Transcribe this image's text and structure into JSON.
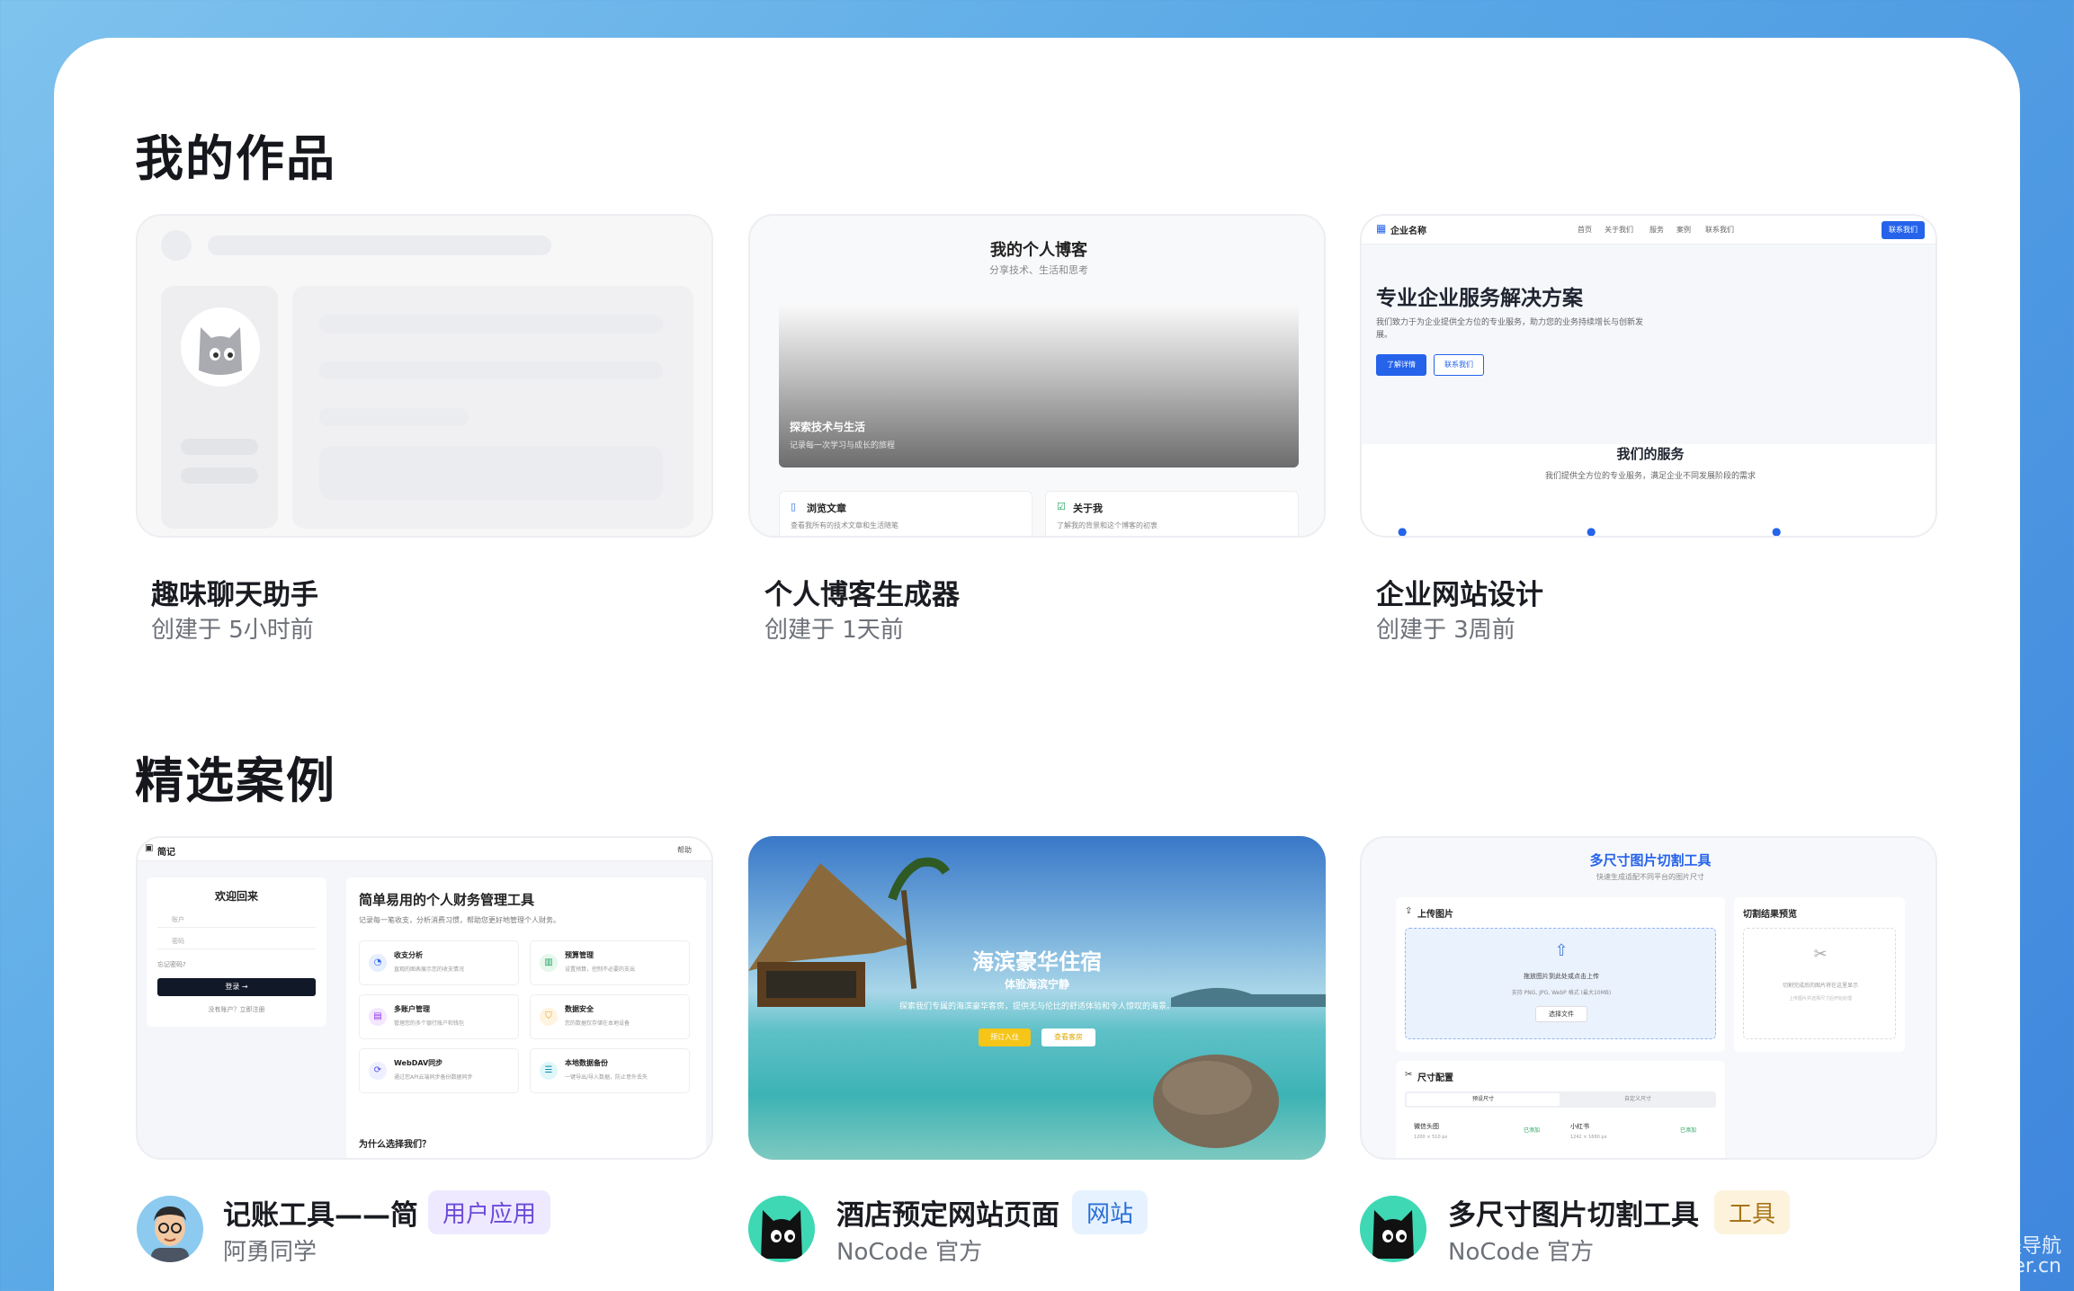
{
  "sections": {
    "my_works_title": "我的作品",
    "featured_title": "精选案例"
  },
  "my_works": [
    {
      "title": "趣味聊天助手",
      "created": "创建于 5小时前"
    },
    {
      "title": "个人博客生成器",
      "created": "创建于 1天前",
      "preview": {
        "title": "我的个人博客",
        "subtitle": "分享技术、生活和思考",
        "hero_title": "探索技术与生活",
        "hero_sub": "记录每一次学习与成长的旅程",
        "card1_title": "浏览文章",
        "card1_desc": "查看我所有的技术文章和生活随笔",
        "card2_title": "关于我",
        "card2_desc": "了解我的背景和这个博客的初衷"
      }
    },
    {
      "title": "企业网站设计",
      "created": "创建于 3周前",
      "preview": {
        "brand": "企业名称",
        "nav": [
          "首页",
          "关于我们",
          "服务",
          "案例",
          "联系我们"
        ],
        "cta": "联系我们",
        "hero_title": "专业企业服务解决方案",
        "hero_desc": "我们致力于为企业提供全方位的专业服务，助力您的业务持续增长与创新发展。",
        "btn_primary": "了解详情",
        "btn_secondary": "联系我们",
        "services_title": "我们的服务",
        "services_desc": "我们提供全方位的专业服务，满足企业不同发展阶段的需求"
      }
    }
  ],
  "featured": [
    {
      "title": "记账工具——简",
      "tag": "用户应用",
      "author": "阿勇同学",
      "preview": {
        "app_name": "简记",
        "help": "帮助",
        "welcome": "欢迎回来",
        "account_placeholder": "账户",
        "password_placeholder": "密码",
        "remember": "忘记密码?",
        "login": "登录 →",
        "register": "没有账户？立即注册",
        "headline": "简单易用的个人财务管理工具",
        "tagline": "记录每一笔收支，分析消费习惯，帮助您更好地管理个人财务。",
        "features": [
          {
            "name": "收支分析",
            "desc": "直观的图表展示您的收支情况"
          },
          {
            "name": "预算管理",
            "desc": "设置预算，控制不必要的支出"
          },
          {
            "name": "多账户管理",
            "desc": "管理您的多个银行账户和钱包"
          },
          {
            "name": "数据安全",
            "desc": "您的数据仅存储在本地设备"
          },
          {
            "name": "WebDAV同步",
            "desc": "通过您API云端同步备份数据同步"
          },
          {
            "name": "本地数据备份",
            "desc": "一键导出/导入数据，防止意外丢失"
          }
        ],
        "why": "为什么选择我们？"
      }
    },
    {
      "title": "酒店预定网站页面",
      "tag": "网站",
      "author": "NoCode 官方",
      "preview": {
        "hero_title": "海滨豪华住宿",
        "hero_sub": "体验海滨宁静",
        "hero_desc": "探索我们专属的海滨豪华客房，提供无与伦比的舒适体验和令人惊叹的海景。",
        "btn_primary": "预订入住",
        "btn_secondary": "查看客房"
      }
    },
    {
      "title": "多尺寸图片切割工具",
      "tag": "工具",
      "author": "NoCode 官方",
      "preview": {
        "title": "多尺寸图片切割工具",
        "subtitle": "快速生成适配不同平台的图片尺寸",
        "upload_title": "上传图片",
        "upload_hint": "拖放图片到此处或点击上传",
        "upload_formats": "支持 PNG, JPG, WebP 格式 (最大10MB)",
        "upload_btn": "选择文件",
        "result_title": "切割结果预览",
        "result_hint": "切割完成后的图片将在这里显示",
        "result_hint2": "上传图片并选择尺寸后开始处理",
        "size_title": "尺寸配置",
        "tab_preset": "预设尺寸",
        "tab_custom": "自定义尺寸",
        "preset1_name": "微信头图",
        "preset1_size": "1200 × 510 px",
        "preset1_action": "已添加",
        "preset2_name": "小红书",
        "preset2_size": "1242 × 1660 px",
        "preset2_action": "已添加"
      }
    }
  ],
  "watermark": {
    "line1": "编程导航",
    "line2": "codefather.cn"
  },
  "colors": {
    "page_bg": "#5aa8e6",
    "tag_app_bg": "#efe9ff",
    "tag_app_fg": "#6b4bd8",
    "tag_web_bg": "#e6f2ff",
    "tag_web_fg": "#2a6fd6",
    "tag_tool_bg": "#fdf3dc",
    "tag_tool_fg": "#a8741a",
    "accent_blue": "#2563eb"
  }
}
